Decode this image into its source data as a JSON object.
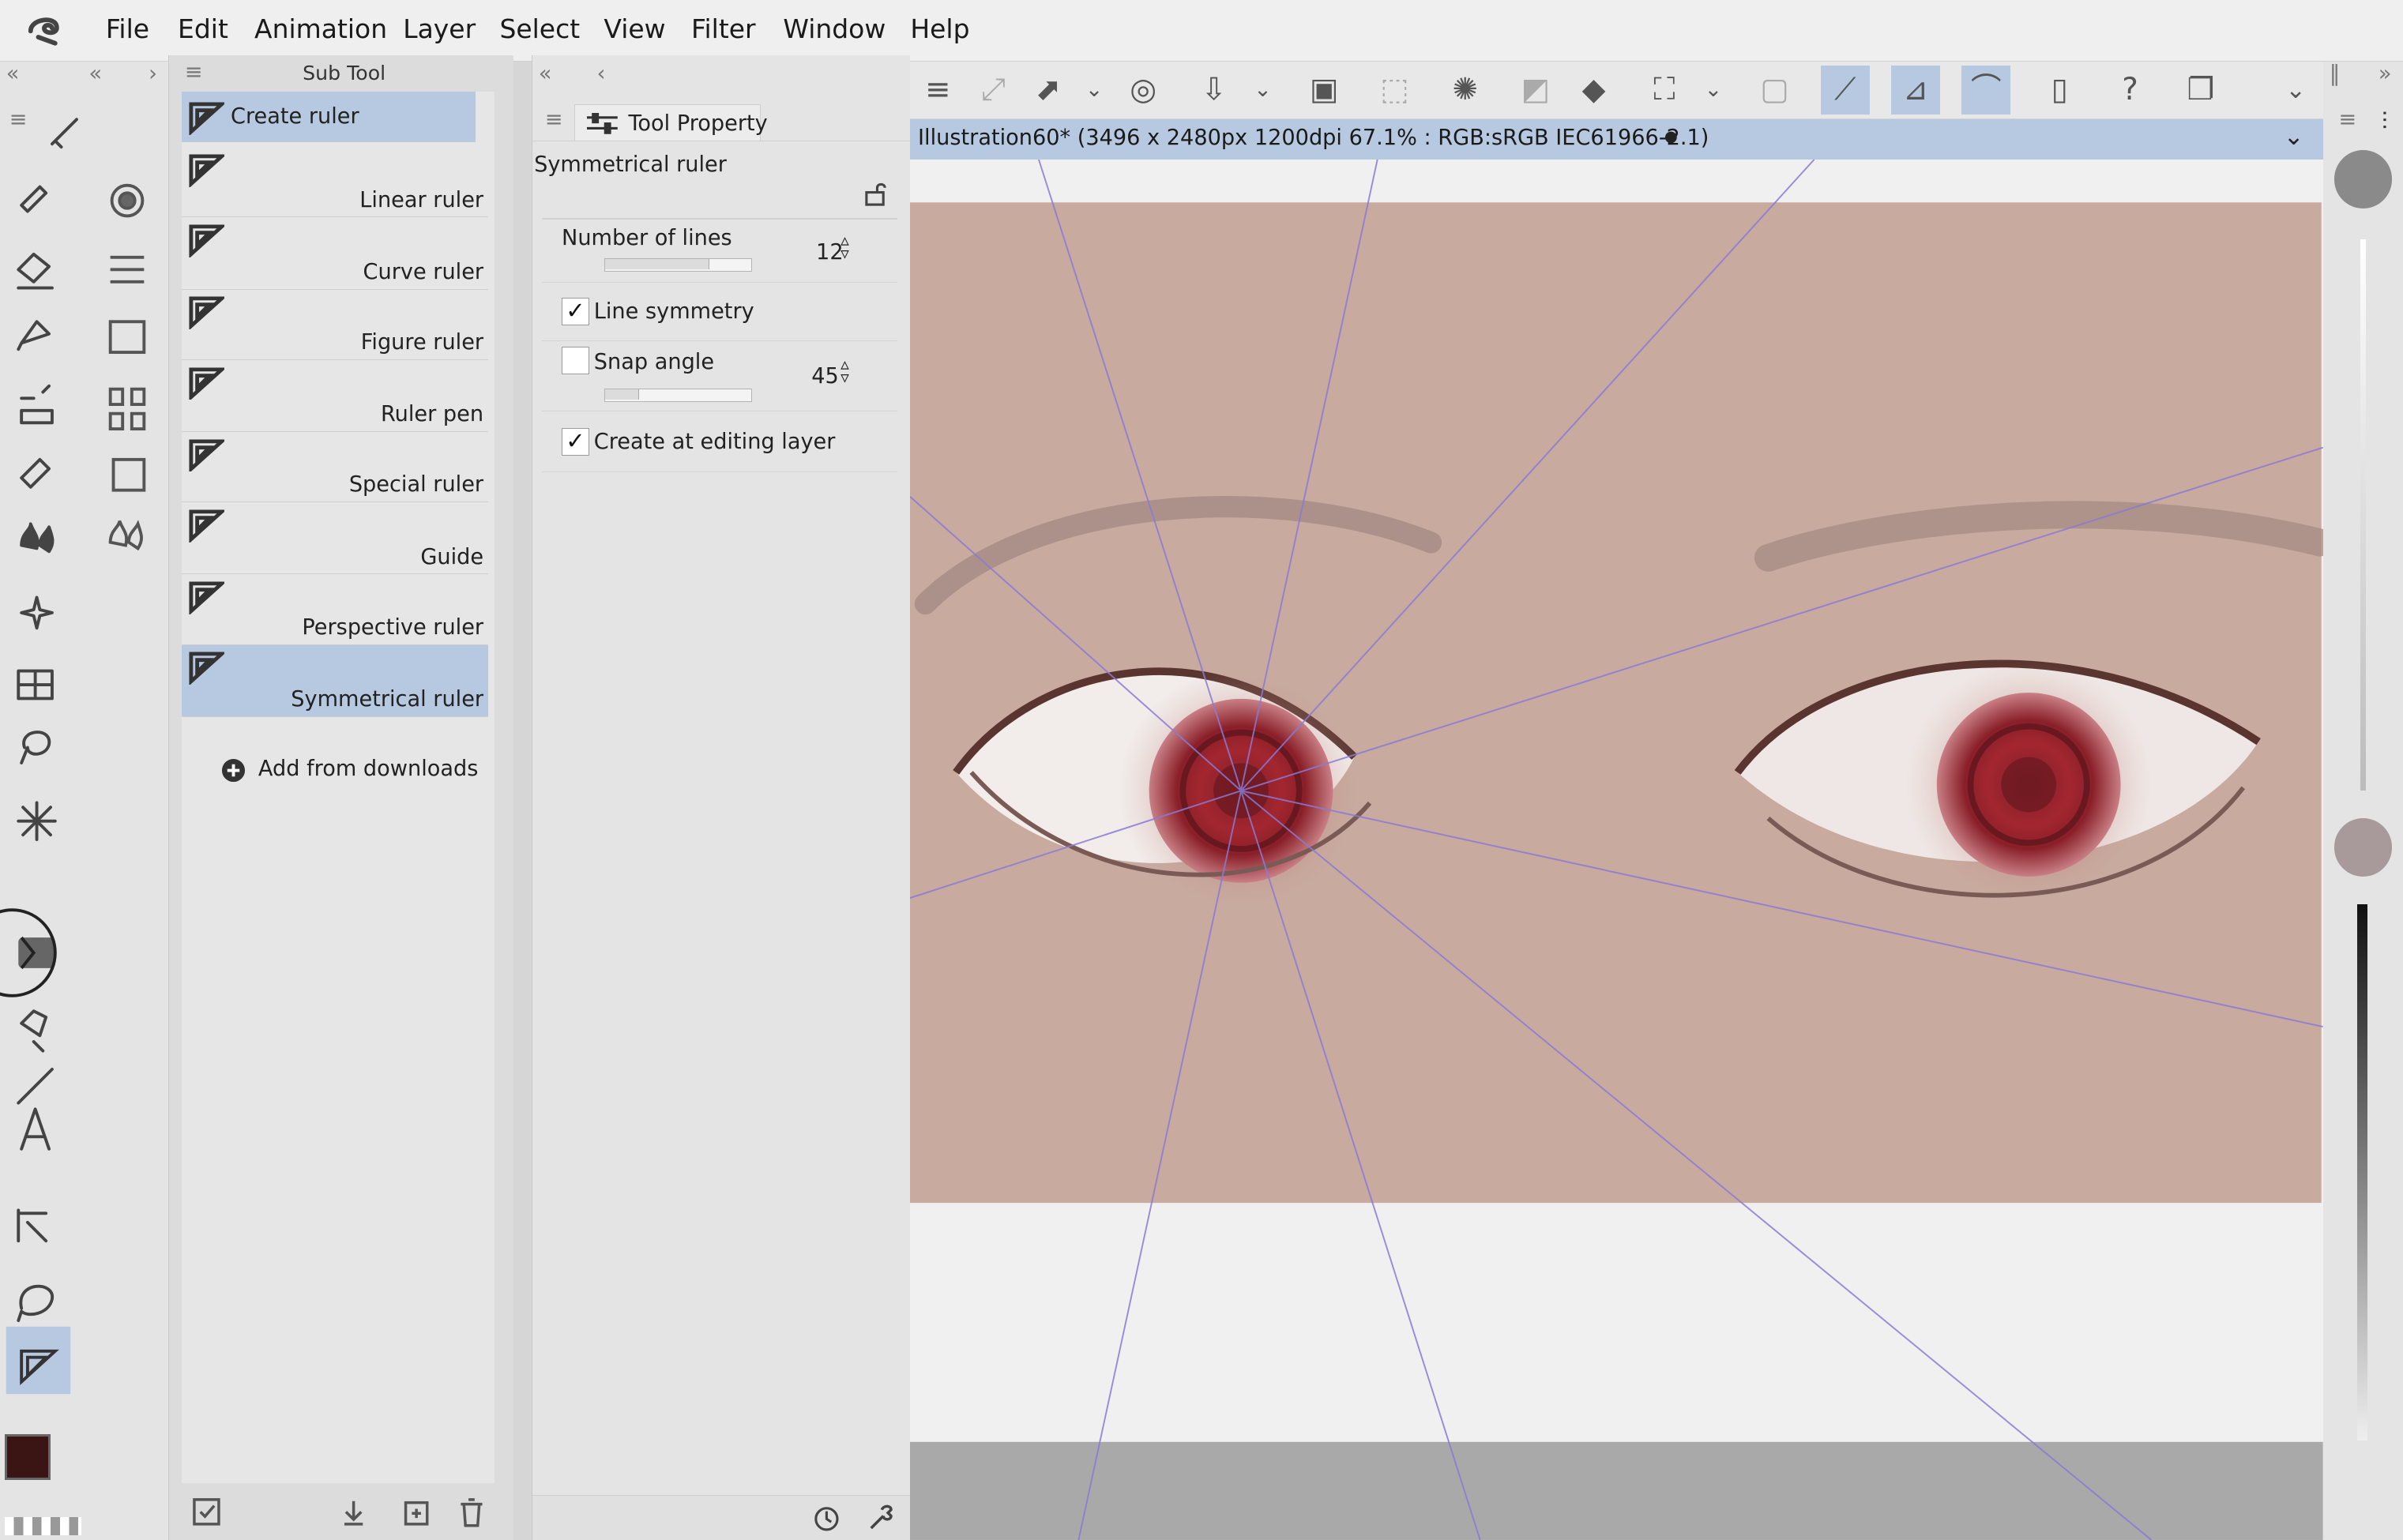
{
  "menu": {
    "items": [
      "File",
      "Edit",
      "Animation",
      "Layer",
      "Select",
      "View",
      "Filter",
      "Window",
      "Help"
    ]
  },
  "subtool": {
    "title": "Sub Tool",
    "items": [
      "Create ruler",
      "Linear ruler",
      "Curve ruler",
      "Figure ruler",
      "Ruler pen",
      "Special ruler",
      "Guide",
      "Perspective ruler",
      "Symmetrical ruler"
    ],
    "selected": "Symmetrical ruler",
    "add_from_downloads": "Add from downloads"
  },
  "tool_property": {
    "tab": "Tool Property",
    "tool_name": "Symmetrical ruler",
    "number_of_lines_label": "Number of lines",
    "number_of_lines_value": "12",
    "line_symmetry_label": "Line symmetry",
    "line_symmetry_checked": true,
    "snap_angle_label": "Snap angle",
    "snap_angle_checked": false,
    "snap_angle_value": "45",
    "create_at_editing_layer_label": "Create at editing layer",
    "create_at_editing_layer_checked": true
  },
  "document": {
    "title": "Illustration60* (3496 x 2480px 1200dpi 67.1% : RGB:sRGB IEC61966-2.1)",
    "modified_dot": "●"
  },
  "colors": {
    "main": "#3b1414",
    "sub": "#000000",
    "canvas": "#c8aa9e",
    "accent_select": "#b7c9e0",
    "ruler_line": "#8a7ad6",
    "iris": "#a3262f"
  },
  "icons": {
    "checkmark": "✓"
  }
}
